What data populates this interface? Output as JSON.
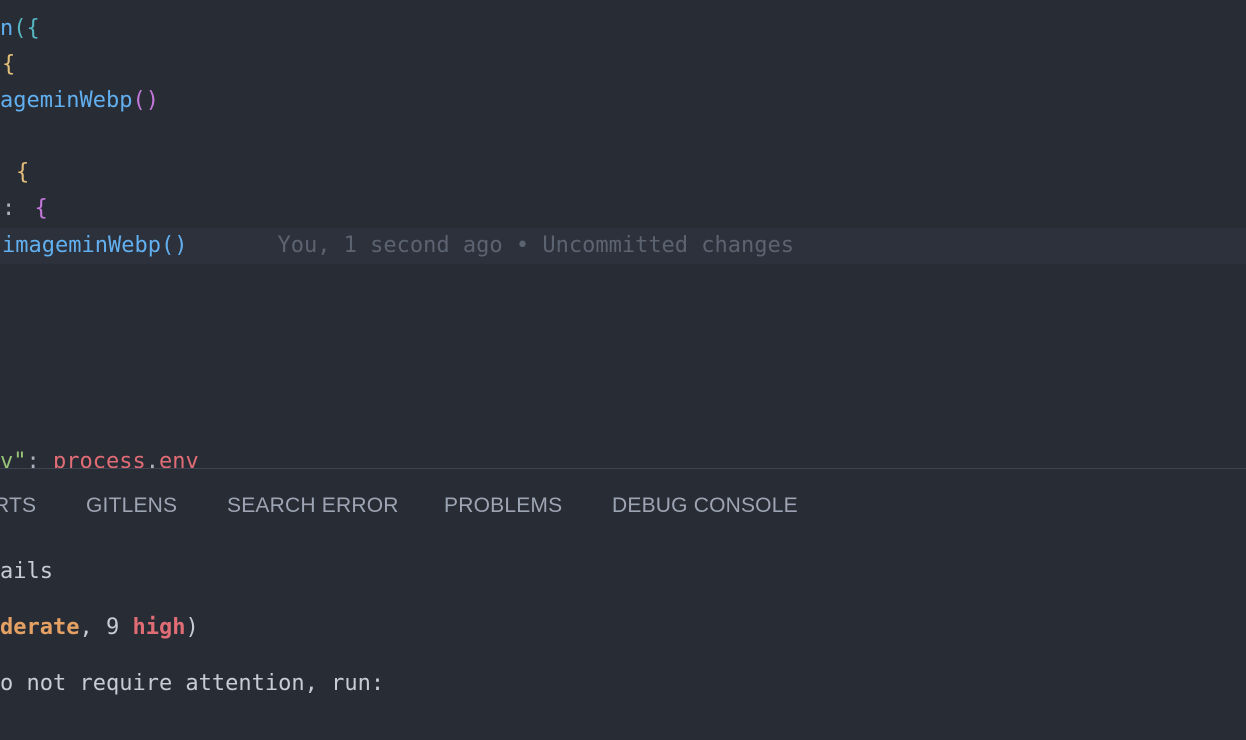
{
  "editor": {
    "lines": [
      {
        "fn": "n",
        "paren": "(",
        "brace": "{"
      },
      {
        "brace": "{"
      },
      {
        "fn": "ageminWebp",
        "parens": "()"
      },
      {
        "brace": "{"
      },
      {
        "colon": ":",
        "brace": "{"
      },
      {
        "fn": "imageminWebp",
        "parens": "()",
        "blame": "You, 1 second ago • Uncommitted changes"
      },
      {
        "str": "v\"",
        "colon": ":",
        "obj": "process",
        "dot": ".",
        "prop": "env"
      }
    ]
  },
  "panel": {
    "tabs": [
      {
        "label": "RTS"
      },
      {
        "label": "GITLENS"
      },
      {
        "label": "SEARCH ERROR"
      },
      {
        "label": "PROBLEMS"
      },
      {
        "label": "DEBUG CONSOLE"
      }
    ],
    "terminal": {
      "line1": "ails",
      "line2_mod": "derate",
      "line2_mid": ", 9 ",
      "line2_high": "high",
      "line2_end": ")",
      "line3": "o not require attention, run:"
    }
  }
}
